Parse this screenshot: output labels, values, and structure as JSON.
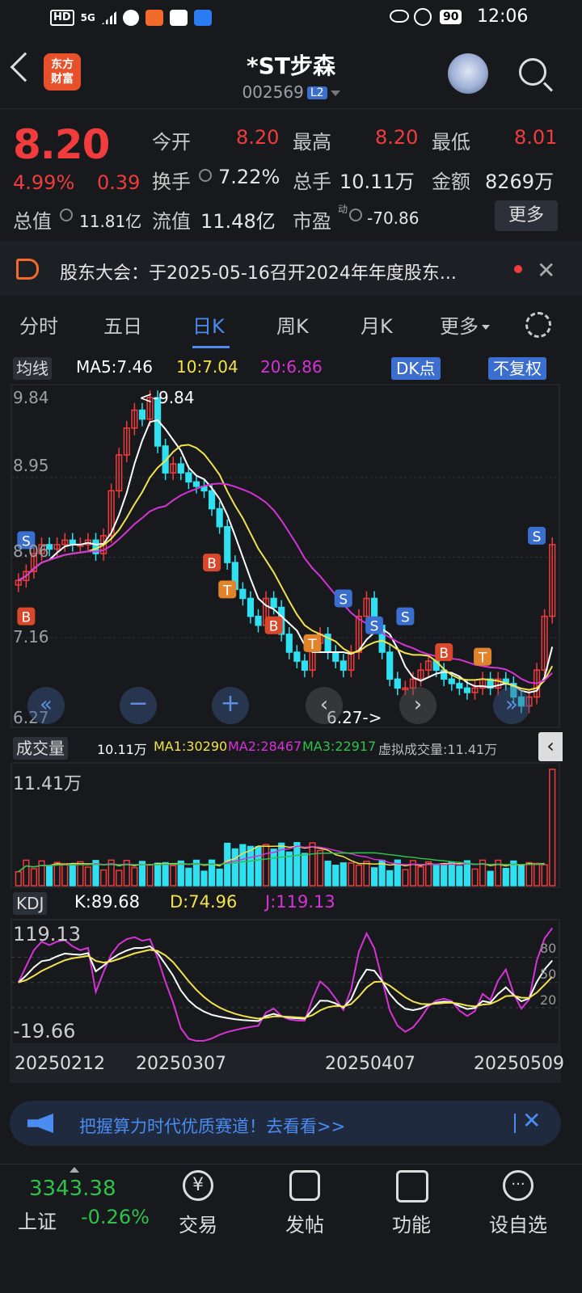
{
  "status": {
    "badge_hd": "HD",
    "network": "5G",
    "battery": "90",
    "time": "12:06"
  },
  "header": {
    "title": "*ST步森",
    "code": "002569",
    "level": "L2",
    "logo_line1": "东方",
    "logo_line2": "财富"
  },
  "quote": {
    "price": "8.20",
    "change_pct": "4.99%",
    "change": "0.39",
    "open_label": "今开",
    "open": "8.20",
    "high_label": "最高",
    "high": "8.20",
    "low_label": "最低",
    "low": "8.01",
    "turnover_label": "换手",
    "turnover": "7.22%",
    "volume_label": "总手",
    "volume": "10.11万",
    "amount_label": "金额",
    "amount": "8269万",
    "total_mv_label": "总值",
    "total_mv": "11.81亿",
    "float_mv_label": "流值",
    "float_mv": "11.48亿",
    "pe_label": "市盈",
    "pe_sup": "动",
    "pe": "-70.86",
    "more": "更多"
  },
  "notice": {
    "text": "股东大会：于2025-05-16召开2024年年度股东..."
  },
  "tabs": [
    "分时",
    "五日",
    "日K",
    "周K",
    "月K",
    "更多"
  ],
  "kline": {
    "ma_button": "均线",
    "ma5": "MA5:7.46",
    "ma10": "10:7.04",
    "ma20": "20:6.86",
    "dk_button": "DK点",
    "adj_button": "不复权",
    "y_labels": [
      "9.84",
      "8.95",
      "8.06",
      "7.16",
      "6.27"
    ],
    "max_marker": "<-9.84",
    "min_marker": "6.27->"
  },
  "volume": {
    "button": "成交量",
    "vol": "10.11万",
    "ma1": "MA1:30290",
    "ma2": "MA2:28467",
    "ma3": "MA3:22917",
    "virtual": "虚拟成交量:11.41万",
    "y_max": "11.41万"
  },
  "kdj": {
    "button": "KDJ",
    "k": "K:89.68",
    "d": "D:74.96",
    "j": "J:119.13",
    "y_max": "119.13",
    "y_min": "-19.66",
    "ref_levels": [
      "80",
      "50",
      "20"
    ]
  },
  "dates": [
    "20250212",
    "20250307",
    "20250407",
    "20250509"
  ],
  "banner": {
    "text": "把握算力时代优质赛道！去看看>>"
  },
  "index": {
    "value": "3343.38",
    "name": "上证",
    "change": "-0.26%"
  },
  "nav": [
    "交易",
    "发帖",
    "功能",
    "设自选"
  ],
  "colors": {
    "up": "#f03c3c",
    "down": "#2fe0f0",
    "accent": "#4a8cf0",
    "ma5": "#ffffff",
    "ma10": "#f2e34d",
    "ma20": "#d633d6",
    "vol_ma3": "#2ec24a"
  }
}
